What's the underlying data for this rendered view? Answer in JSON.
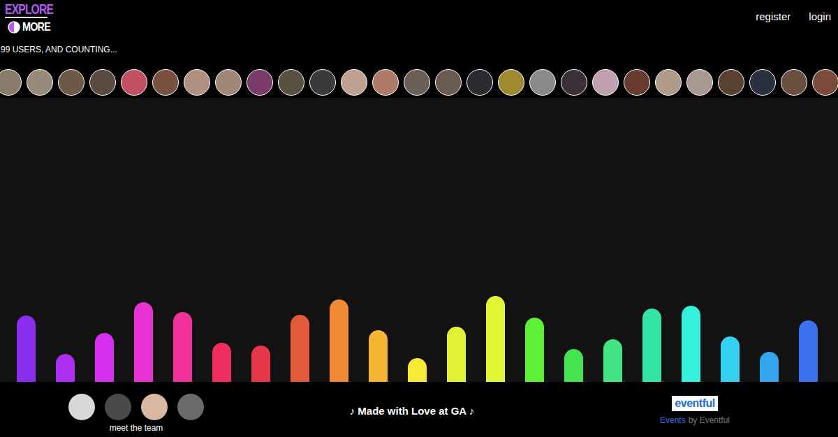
{
  "logo": {
    "top": "EXPLORE",
    "bottom": "MORE"
  },
  "nav": [
    {
      "label": "register"
    },
    {
      "label": "login"
    }
  ],
  "user_count": "99 USERS, AND COUNTING...",
  "avatars": [
    {
      "color": "#8a7a6a"
    },
    {
      "color": "#9a8a7c"
    },
    {
      "color": "#6b5a48"
    },
    {
      "color": "#5a4a40"
    },
    {
      "color": "#c25060"
    },
    {
      "color": "#7a5040"
    },
    {
      "color": "#b09080"
    },
    {
      "color": "#a08878"
    },
    {
      "color": "#7a3a6a"
    },
    {
      "color": "#5a5040"
    },
    {
      "color": "#3a3a3a"
    },
    {
      "color": "#c0a090"
    },
    {
      "color": "#b07a68"
    },
    {
      "color": "#6a6058"
    },
    {
      "color": "#6a5a50"
    },
    {
      "color": "#2a2a30"
    },
    {
      "color": "#a08a30"
    },
    {
      "color": "#8a8a88"
    },
    {
      "color": "#3a3038"
    },
    {
      "color": "#c0a0b0"
    },
    {
      "color": "#6a3a30"
    },
    {
      "color": "#b09a88"
    },
    {
      "color": "#a89890"
    },
    {
      "color": "#5a4030"
    },
    {
      "color": "#2a3040"
    },
    {
      "color": "#6a5040"
    },
    {
      "color": "#7a4a3a"
    }
  ],
  "visualizer": {
    "bars": [
      {
        "value": 95,
        "color": "#8a2ff0"
      },
      {
        "value": 40,
        "color": "#ab2ef2"
      },
      {
        "value": 70,
        "color": "#d72ef2"
      },
      {
        "value": 114,
        "color": "#e932d2"
      },
      {
        "value": 100,
        "color": "#f2309b"
      },
      {
        "value": 56,
        "color": "#f02e62"
      },
      {
        "value": 52,
        "color": "#e6384a"
      },
      {
        "value": 96,
        "color": "#e35a3a"
      },
      {
        "value": 118,
        "color": "#f08a34"
      },
      {
        "value": 74,
        "color": "#f6b634"
      },
      {
        "value": 34,
        "color": "#f6ea34"
      },
      {
        "value": 79,
        "color": "#e2f234"
      },
      {
        "value": 123,
        "color": "#e0f834"
      },
      {
        "value": 92,
        "color": "#5ef034"
      },
      {
        "value": 47,
        "color": "#42e452"
      },
      {
        "value": 61,
        "color": "#42e484"
      },
      {
        "value": 105,
        "color": "#34e4a4"
      },
      {
        "value": 109,
        "color": "#34f0dc"
      },
      {
        "value": 65,
        "color": "#34d2f2"
      },
      {
        "value": 43,
        "color": "#34a6f0"
      },
      {
        "value": 88,
        "color": "#3a72f0"
      }
    ]
  },
  "footer": {
    "team": [
      {
        "color": "#d8d8d8"
      },
      {
        "color": "#4a4a4a"
      },
      {
        "color": "#d8b8a0"
      },
      {
        "color": "#6a6a6a"
      }
    ],
    "team_label": "meet the team",
    "credit": "♪ Made with Love at GA ♪",
    "partner_logo": "eventful",
    "partner_link": "Events",
    "partner_by": "by Eventful"
  }
}
